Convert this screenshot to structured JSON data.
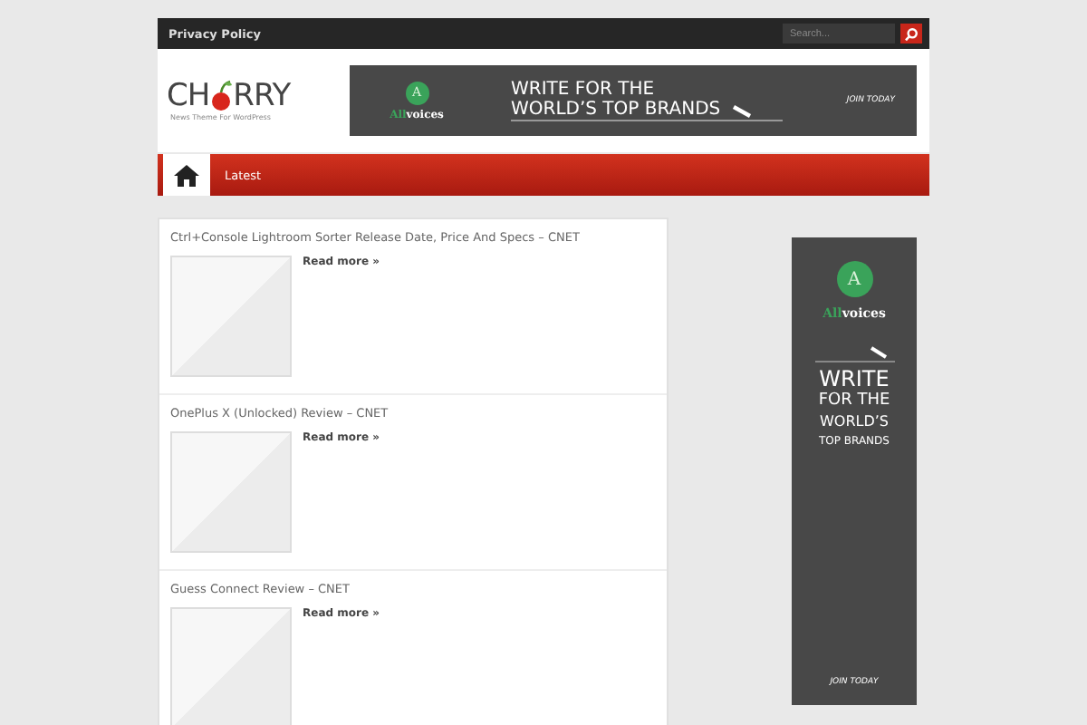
{
  "top_bar": {
    "link": "Privacy Policy",
    "search": {
      "placeholder": "Search..."
    }
  },
  "logo": {
    "before": "CH",
    "after": "RRY",
    "tagline": "News Theme For WordPress"
  },
  "header_ad": {
    "badge": "A",
    "brand_a": "All",
    "brand_b": "voices",
    "line_1": "WRITE FOR THE",
    "line_2": "WORLD’S TOP BRANDS",
    "cta": "JOIN TODAY"
  },
  "nav": {
    "items": [
      {
        "kind": "home",
        "selected": true
      },
      {
        "kind": "text",
        "label": "Latest",
        "selected": false
      }
    ]
  },
  "posts": [
    {
      "title": "Ctrl+Console Lightroom Sorter Release Date, Price And Specs – CNET",
      "more": "Read more »"
    },
    {
      "title": "OnePlus X (Unlocked) Review – CNET",
      "more": "Read more »"
    },
    {
      "title": "Guess Connect Review – CNET",
      "more": "Read more »"
    }
  ],
  "side_ad": {
    "badge": "A",
    "brand_a": "All",
    "brand_b": "voices",
    "lines": [
      "WRITE",
      "FOR THE",
      "WORLD’S",
      "TOP BRANDS"
    ],
    "cta": "JOIN TODAY"
  }
}
